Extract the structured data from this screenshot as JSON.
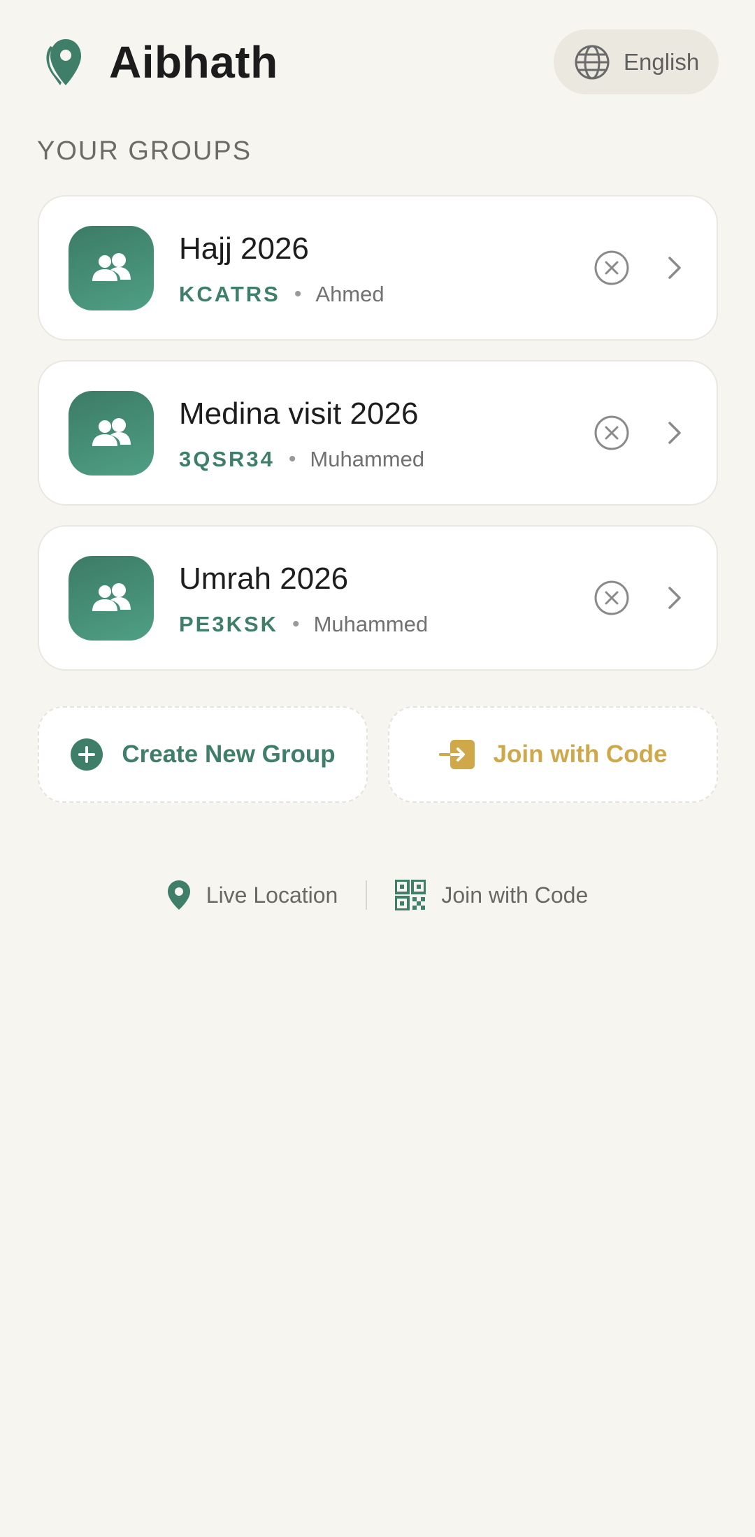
{
  "app": {
    "title": "Aibhath"
  },
  "language": {
    "label": "English"
  },
  "groups_section": {
    "title": "YOUR GROUPS"
  },
  "groups": [
    {
      "name": "Hajj 2026",
      "code": "KCATRS",
      "owner": "Ahmed"
    },
    {
      "name": "Medina visit 2026",
      "code": "3QSR34",
      "owner": "Muhammed"
    },
    {
      "name": "Umrah 2026",
      "code": "PE3KSK",
      "owner": "Muhammed"
    }
  ],
  "actions": {
    "create_label": "Create New Group",
    "join_label": "Join with Code"
  },
  "footer": {
    "live_location_label": "Live Location",
    "join_code_label": "Join with Code"
  },
  "colors": {
    "background": "#f6f5f0",
    "brand_green": "#3f7f6a",
    "accent_gold": "#cfa84a",
    "text_primary": "#1c1c1c",
    "text_muted": "#717171"
  },
  "icons": {
    "brand": "location-pin-icon",
    "language": "globe-icon",
    "group": "users-icon",
    "leave": "close-circle-icon",
    "open": "chevron-right-icon",
    "create": "plus-circle-icon",
    "join": "sign-in-icon",
    "live_location": "map-pin-icon",
    "qr": "qr-code-icon"
  }
}
